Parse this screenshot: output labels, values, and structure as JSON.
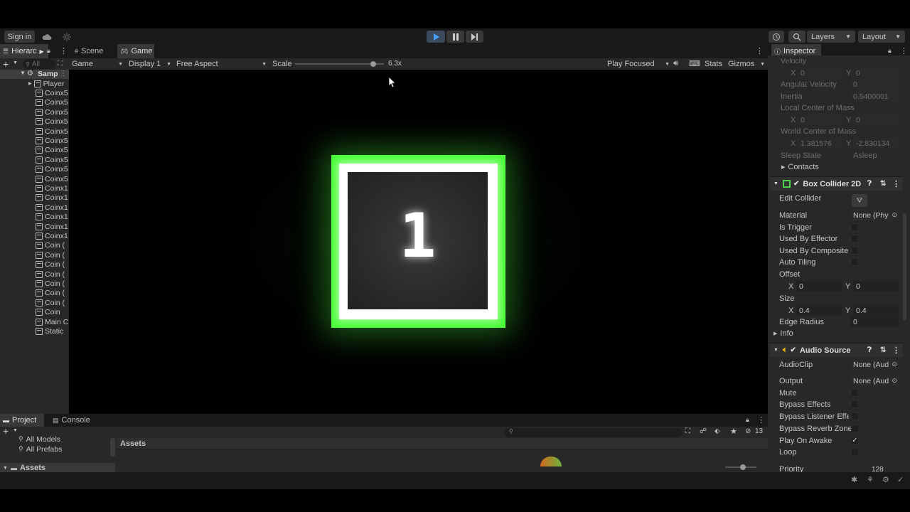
{
  "toolbar": {
    "sign_in": "Sign in",
    "layers": "Layers",
    "layout": "Layout"
  },
  "hierarchy": {
    "tab": "Hierarc",
    "search_placeholder": "All",
    "scene": "Samp",
    "items": [
      "Player",
      "Coinx5",
      "Coinx5",
      "Coinx5",
      "Coinx5",
      "Coinx5",
      "Coinx5",
      "Coinx5",
      "Coinx5",
      "Coinx5",
      "Coinx5",
      "Coinx1",
      "Coinx1",
      "Coinx1",
      "Coinx1",
      "Coinx1",
      "Coinx1",
      "Coin (",
      "Coin (",
      "Coin (",
      "Coin (",
      "Coin (",
      "Coin (",
      "Coin (",
      "Coin",
      "Main C",
      "Static"
    ]
  },
  "game_view": {
    "tab_scene": "Scene",
    "tab_game": "Game",
    "mode": "Game",
    "display": "Display 1",
    "aspect": "Free Aspect",
    "scale_label": "Scale",
    "scale_value": "6.3x",
    "scale_fraction": 0.88,
    "play_focused": "Play Focused",
    "stats": "Stats",
    "gizmos": "Gizmos",
    "box_number": "1",
    "box_color": "#4cff3a"
  },
  "inspector": {
    "tab": "Inspector",
    "velocity_label": "Velocity",
    "velocity_x": "0",
    "velocity_y": "0",
    "angular_velocity_label": "Angular Velocity",
    "angular_velocity": "0",
    "inertia_label": "Inertia",
    "inertia": "0.5400001",
    "local_com_label": "Local Center of Mass",
    "local_com_x": "0",
    "local_com_y": "0",
    "world_com_label": "World Center of Mass",
    "world_com_x": "1.381576",
    "world_com_y": "-2.830134",
    "sleep_state_label": "Sleep State",
    "sleep_state": "Asleep",
    "contacts": "Contacts",
    "x": "X",
    "y": "Y",
    "box_collider": {
      "title": "Box Collider 2D",
      "edit_collider": "Edit Collider",
      "material": "Material",
      "material_value": "None (Phy",
      "is_trigger": "Is Trigger",
      "used_by_effector": "Used By Effector",
      "used_by_composite": "Used By Composite",
      "auto_tiling": "Auto Tiling",
      "offset": "Offset",
      "offset_x": "0",
      "offset_y": "0",
      "size": "Size",
      "size_x": "0.4",
      "size_y": "0.4",
      "edge_radius": "Edge Radius",
      "edge_radius_value": "0",
      "info": "Info"
    },
    "audio_source": {
      "title": "Audio Source",
      "audio_clip": "AudioClip",
      "audio_clip_value": "None (Aud",
      "output": "Output",
      "output_value": "None (Aud",
      "mute": "Mute",
      "bypass_effects": "Bypass Effects",
      "bypass_listener": "Bypass Listener Effe",
      "bypass_reverb": "Bypass Reverb Zone",
      "play_on_awake": "Play On Awake",
      "loop": "Loop",
      "priority": "Priority",
      "priority_value": "128"
    }
  },
  "project": {
    "tab_project": "Project",
    "tab_console": "Console",
    "all_models": "All Models",
    "all_prefabs": "All Prefabs",
    "assets_folder": "Assets",
    "assets_header": "Assets",
    "hidden_count": "13"
  }
}
